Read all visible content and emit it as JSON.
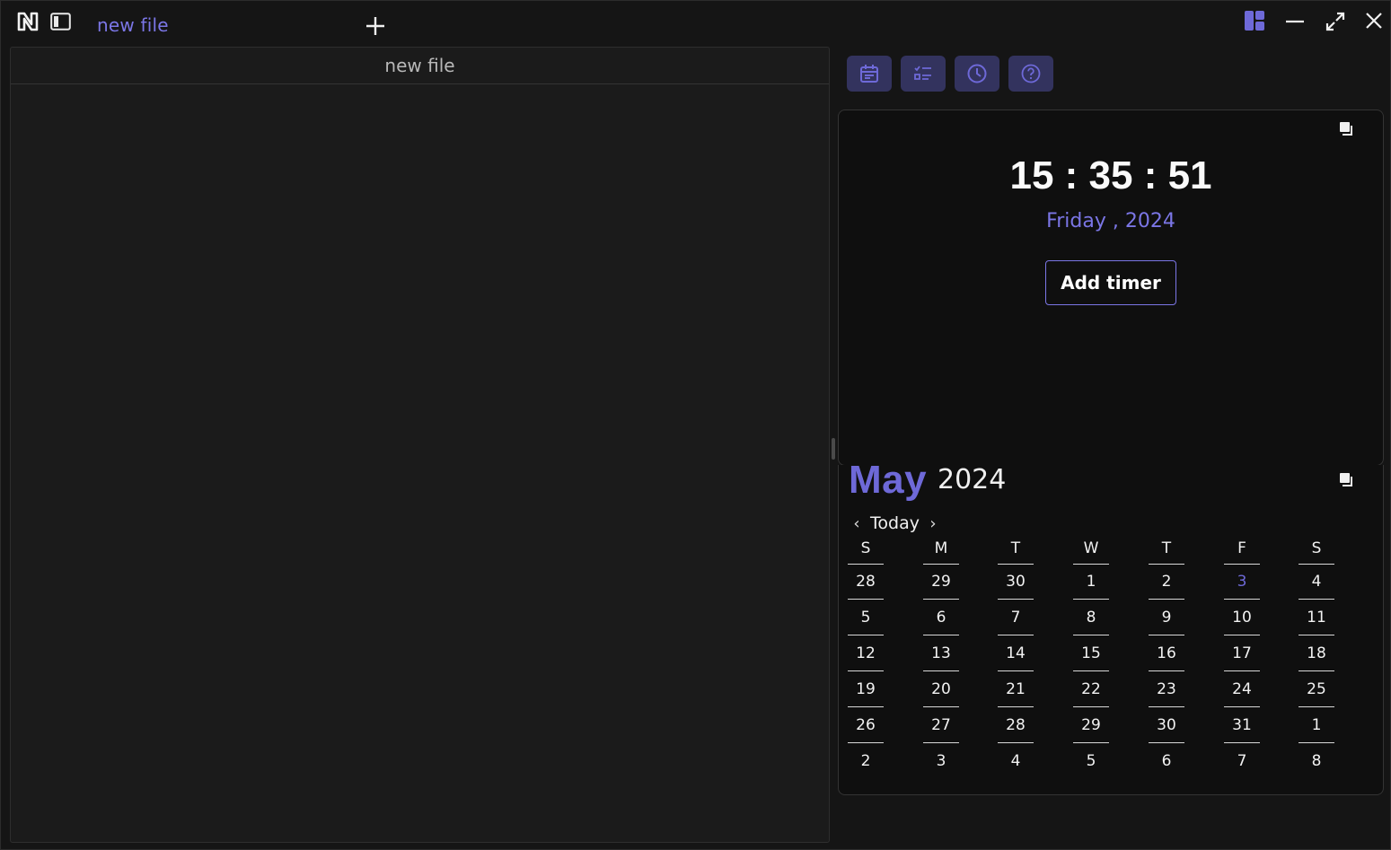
{
  "titlebar": {
    "tab_title": "new file",
    "icons": {
      "logo": "notes-logo-icon",
      "sidebar": "sidebar-toggle-icon",
      "new_tab": "plus-icon",
      "layout": "layout-icon",
      "minimize": "minimize-icon",
      "maximize": "maximize-icon",
      "close": "close-icon"
    }
  },
  "editor": {
    "title": "new file"
  },
  "toolbar": {
    "buttons": [
      {
        "icon": "calendar-icon"
      },
      {
        "icon": "checklist-icon"
      },
      {
        "icon": "clock-icon"
      },
      {
        "icon": "help-icon"
      }
    ]
  },
  "clock": {
    "time": "15 : 35 : 51",
    "date": "Friday , 2024",
    "add_timer_label": "Add timer"
  },
  "calendar": {
    "month": "May",
    "year": "2024",
    "today_label": "Today",
    "prev_icon": "chevron-left-icon",
    "next_icon": "chevron-right-icon",
    "weekdays": [
      "S",
      "M",
      "T",
      "W",
      "T",
      "F",
      "S"
    ],
    "weeks": [
      [
        "28",
        "29",
        "30",
        "1",
        "2",
        "3",
        "4"
      ],
      [
        "5",
        "6",
        "7",
        "8",
        "9",
        "10",
        "11"
      ],
      [
        "12",
        "13",
        "14",
        "15",
        "16",
        "17",
        "18"
      ],
      [
        "19",
        "20",
        "21",
        "22",
        "23",
        "24",
        "25"
      ],
      [
        "26",
        "27",
        "28",
        "29",
        "30",
        "31",
        "1"
      ],
      [
        "2",
        "3",
        "4",
        "5",
        "6",
        "7",
        "8"
      ]
    ],
    "highlighted_day": "3"
  },
  "colors": {
    "accent": "#7b76e6",
    "accent_dark": "#33335e",
    "background": "#151515",
    "card": "#0f0f0f",
    "editor": "#1b1b1b"
  }
}
